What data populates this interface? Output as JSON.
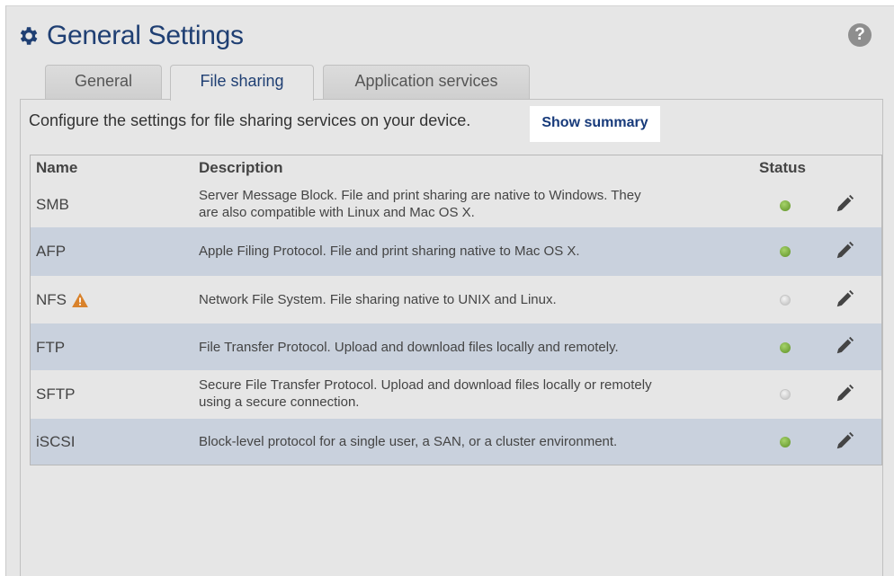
{
  "header": {
    "title": "General Settings",
    "icon": "gear-icon",
    "help_label": "?"
  },
  "tabs": [
    {
      "label": "General",
      "active": false
    },
    {
      "label": "File sharing",
      "active": true
    },
    {
      "label": "Application services",
      "active": false
    }
  ],
  "intro_text": "Configure the settings for file sharing services on your device.",
  "summary_link": "Show summary",
  "table": {
    "columns": [
      "Name",
      "Description",
      "Status"
    ],
    "rows": [
      {
        "name": "SMB",
        "desc_line1": "Server Message Block. File and print sharing are native to Windows. They",
        "desc_line2": "are also compatible with Linux and Mac OS X.",
        "status": "on",
        "warning": false
      },
      {
        "name": "AFP",
        "desc_line1": "Apple Filing Protocol. File and print sharing native to Mac OS X.",
        "desc_line2": "",
        "status": "on",
        "warning": false
      },
      {
        "name": "NFS",
        "desc_line1": "Network File System. File sharing native to UNIX and Linux.",
        "desc_line2": "",
        "status": "off",
        "warning": true
      },
      {
        "name": "FTP",
        "desc_line1": "File Transfer Protocol. Upload and download files locally and remotely.",
        "desc_line2": "",
        "status": "on",
        "warning": false
      },
      {
        "name": "SFTP",
        "desc_line1": "Secure File Transfer Protocol. Upload and download files locally or remotely",
        "desc_line2": "using a secure connection.",
        "status": "off",
        "warning": false
      },
      {
        "name": "iSCSI",
        "desc_line1": "Block-level protocol for a single user, a SAN, or a cluster environment.",
        "desc_line2": "",
        "status": "on",
        "warning": false
      }
    ]
  },
  "colors": {
    "accent": "#1f3f73",
    "status_on": "#6aa332",
    "status_off": "#d0d0d0",
    "row_alt": "#c9d1dd",
    "warning": "#d9822b"
  }
}
